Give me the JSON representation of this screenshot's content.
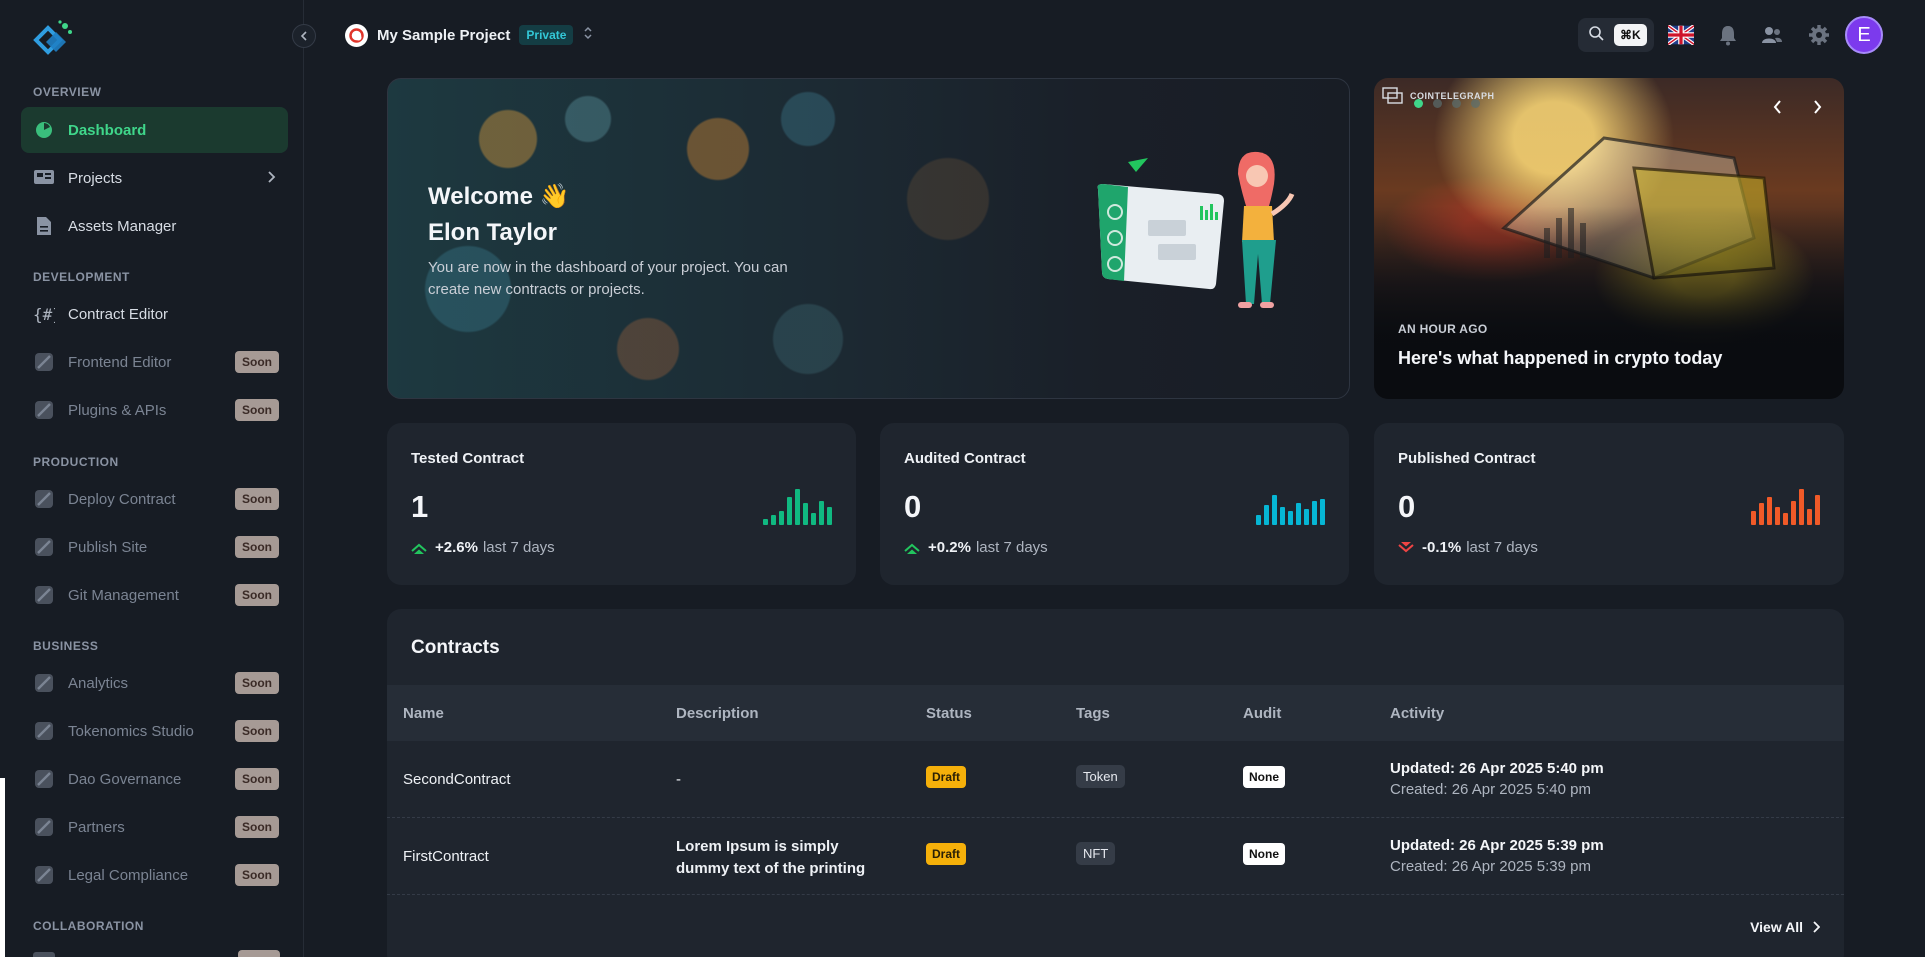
{
  "sidebar": {
    "sections": {
      "overview": "OVERVIEW",
      "development": "DEVELOPMENT",
      "production": "PRODUCTION",
      "business": "BUSINESS",
      "collaboration": "COLLABORATION"
    },
    "items": {
      "dashboard": "Dashboard",
      "projects": "Projects",
      "assets_manager": "Assets Manager",
      "contract_editor": "Contract Editor",
      "frontend_editor": "Frontend Editor",
      "plugins_apis": "Plugins & APIs",
      "deploy_contract": "Deploy Contract",
      "publish_site": "Publish Site",
      "git_management": "Git Management",
      "analytics": "Analytics",
      "tokenomics_studio": "Tokenomics Studio",
      "dao_governance": "Dao Governance",
      "partners": "Partners",
      "legal_compliance": "Legal Compliance"
    },
    "soon_label": "Soon"
  },
  "header": {
    "project_name": "My Sample Project",
    "visibility": "Private",
    "search_shortcut": "⌘K",
    "avatar_initial": "E"
  },
  "welcome": {
    "line1": "Welcome 👋",
    "line2": "Elon Taylor",
    "description": "You are now in the dashboard of your project. You can create new contracts or projects."
  },
  "news": {
    "source": "COINTELEGRAPH",
    "time": "AN HOUR AGO",
    "title": "Here's what happened in crypto today",
    "slide_count": 4,
    "active_slide": 1
  },
  "stats": [
    {
      "label": "Tested Contract",
      "value": "1",
      "trend": "+2.6%",
      "period": "last 7 days",
      "direction": "up",
      "color": "#10b981"
    },
    {
      "label": "Audited Contract",
      "value": "0",
      "trend": "+0.2%",
      "period": "last 7 days",
      "direction": "up",
      "color": "#06b6d4"
    },
    {
      "label": "Published Contract",
      "value": "0",
      "trend": "-0.1%",
      "period": "last 7 days",
      "direction": "down",
      "color": "#f05a28"
    }
  ],
  "contracts": {
    "title": "Contracts",
    "columns": [
      "Name",
      "Description",
      "Status",
      "Tags",
      "Audit",
      "Activity"
    ],
    "rows": [
      {
        "name": "SecondContract",
        "description": "-",
        "status": "Draft",
        "tag": "Token",
        "audit": "None",
        "updated": "Updated: 26 Apr 2025 5:40 pm",
        "created": "Created: 26 Apr 2025 5:40 pm"
      },
      {
        "name": "FirstContract",
        "description": "Lorem Ipsum is simply dummy text of the printing",
        "status": "Draft",
        "tag": "NFT",
        "audit": "None",
        "updated": "Updated: 26 Apr 2025 5:39 pm",
        "created": "Created: 26 Apr 2025 5:39 pm"
      }
    ],
    "view_all": "View All"
  }
}
